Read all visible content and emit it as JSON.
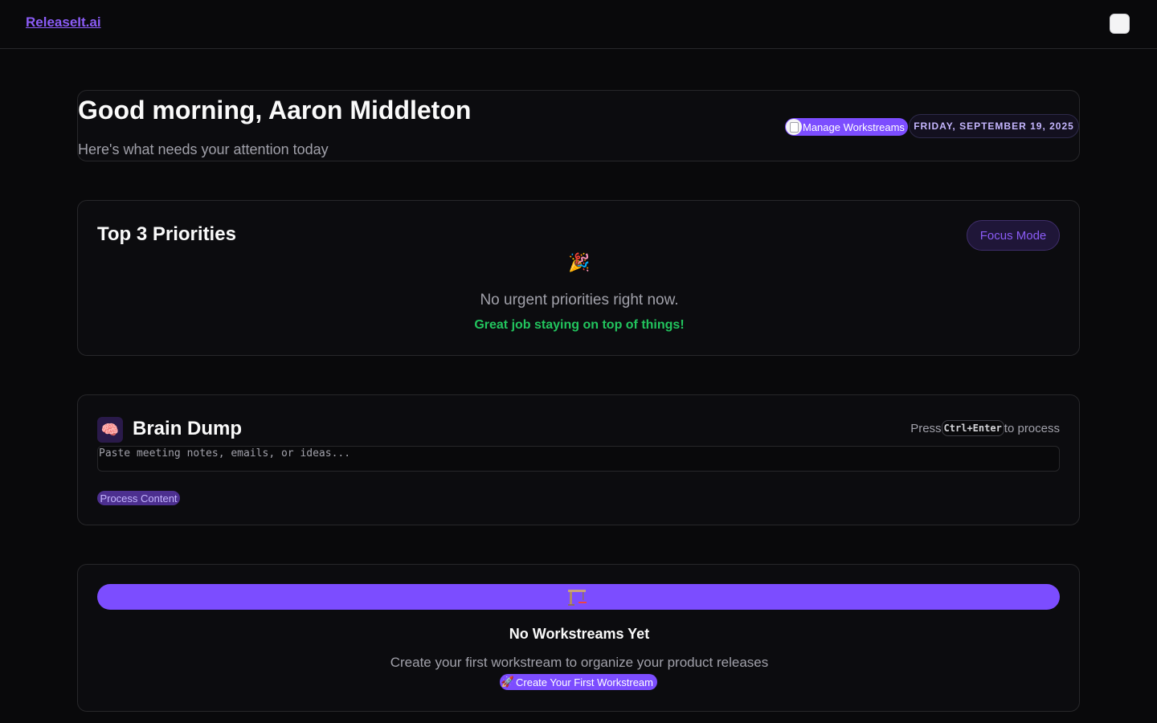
{
  "topbar": {
    "brand": "ReleaseIt.ai",
    "theme_toggle_icon": "theme-toggle-icon"
  },
  "header": {
    "greeting": "Good morning, Aaron Middleton",
    "subtitle": "Here's what needs your attention today",
    "manage_label": "Manage Workstreams",
    "manage_icon": "clipboard-icon",
    "date": "FRIDAY, SEPTEMBER 19, 2025"
  },
  "priorities": {
    "title": "Top 3 Priorities",
    "focus_label": "Focus Mode",
    "empty_icon": "🎉",
    "empty_text": "No urgent priorities right now.",
    "empty_subtext": "Great job staying on top of things!",
    "success_color": "#22c55e"
  },
  "brain_dump": {
    "icon": "🧠",
    "title": "Brain Dump",
    "hint_prefix": "Press",
    "hint_key": "Ctrl+Enter",
    "hint_suffix": "to process",
    "placeholder": "Paste meeting notes, emails, or ideas...",
    "value": "",
    "process_label": "Process Content"
  },
  "workstreams": {
    "empty_icon": "crane-icon",
    "empty_title": "No Workstreams Yet",
    "empty_text": "Create your first workstream to organize your product releases",
    "create_icon": "🚀",
    "create_label": "Create Your First Workstream",
    "accent_color": "#7c4dff"
  }
}
